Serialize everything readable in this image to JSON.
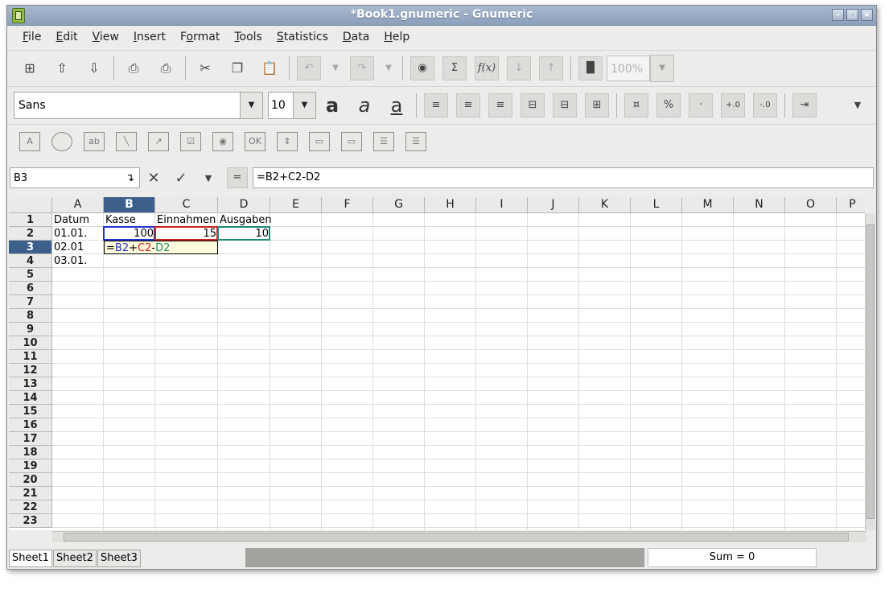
{
  "window": {
    "title": "*Book1.gnumeric - Gnumeric"
  },
  "menu": [
    "File",
    "Edit",
    "View",
    "Insert",
    "Format",
    "Tools",
    "Statistics",
    "Data",
    "Help"
  ],
  "menu_accel": [
    "F",
    "E",
    "V",
    "I",
    "o",
    "T",
    "S",
    "D",
    "H"
  ],
  "toolbar": {
    "zoom": "100%",
    "font_name": "Sans",
    "font_size": "10"
  },
  "entry": {
    "cell_ref": "B3",
    "formula": "=B2+C2-D2"
  },
  "grid": {
    "columns": [
      "A",
      "B",
      "C",
      "D",
      "E",
      "F",
      "G",
      "H",
      "I",
      "J",
      "K",
      "L",
      "M",
      "N",
      "O",
      "P"
    ],
    "rows": [
      "1",
      "2",
      "3",
      "4",
      "5",
      "6",
      "7",
      "8",
      "9",
      "10",
      "11",
      "12",
      "13",
      "14",
      "15",
      "16",
      "17",
      "18",
      "19",
      "20",
      "21",
      "22",
      "23"
    ],
    "selected_column": "B",
    "selected_row": "3",
    "cells": {
      "A1": "Datum",
      "B1": "Kasse",
      "C1": "Einnahmen",
      "D1": "Ausgaben",
      "A2": "01.01.",
      "B2": "100",
      "C2": "15",
      "D2": "10",
      "A3": "02.01",
      "A4": "03.01."
    },
    "editing": {
      "prefix": "=",
      "ref1": "B2",
      "op1": "+",
      "ref2": "C2",
      "op2": "-",
      "ref3": "D2"
    }
  },
  "sheets": [
    "Sheet1",
    "Sheet2",
    "Sheet3"
  ],
  "status": {
    "sum": "Sum = 0"
  },
  "colors": {
    "selection": "#3d5f8b",
    "ref_blue": "#2233cc",
    "ref_red": "#cc2222",
    "ref_teal": "#1f8a7a",
    "edit_bg": "#fffbdc"
  }
}
